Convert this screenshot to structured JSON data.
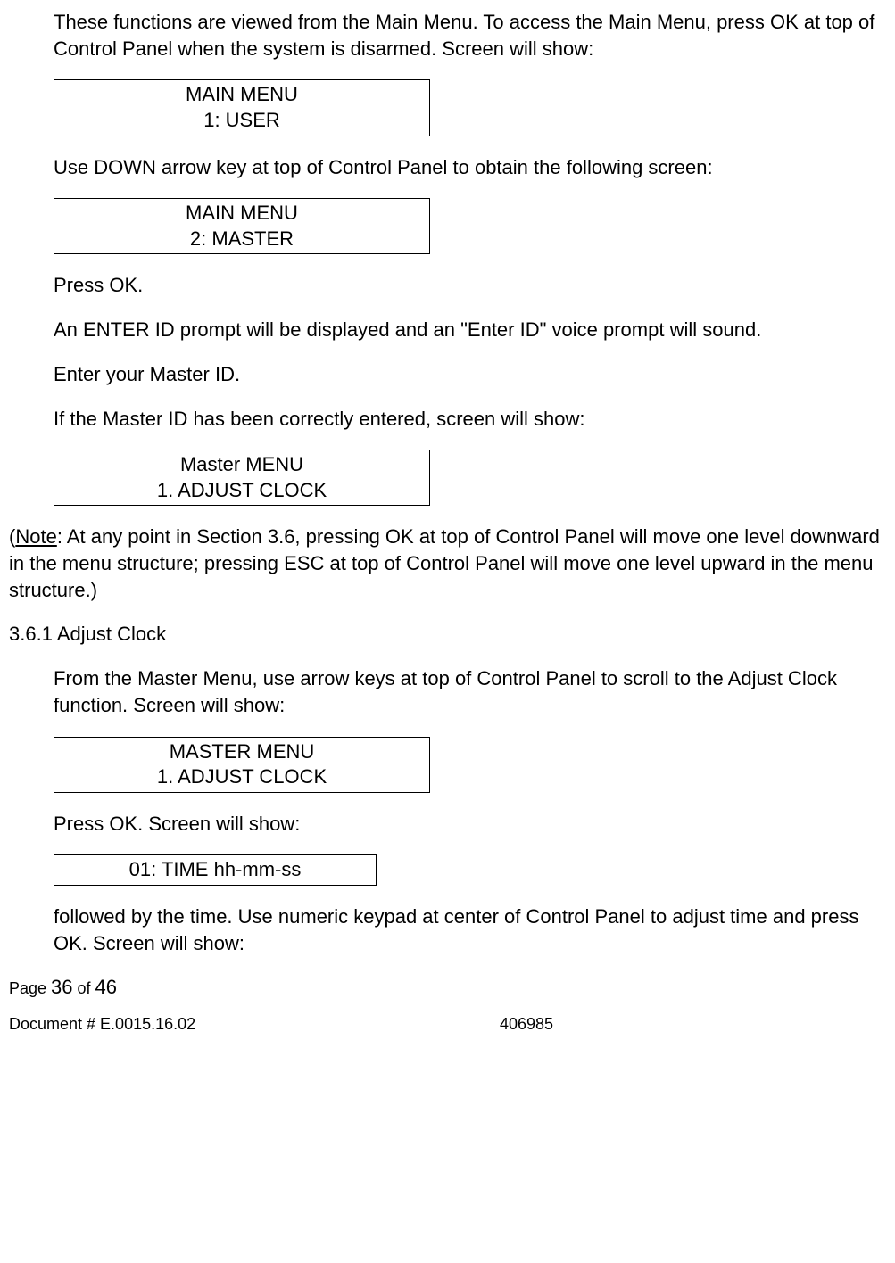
{
  "para1": "These functions are viewed from the Main Menu. To access the Main Menu, press OK at top of Control Panel when the system is disarmed. Screen will show:",
  "screen1": {
    "line1": "MAIN MENU",
    "line2": "1: USER"
  },
  "para2": "Use DOWN arrow key at top of Control Panel to obtain the following screen:",
  "screen2": {
    "line1": "MAIN MENU",
    "line2": "2: MASTER"
  },
  "para3": "Press OK.",
  "para4": "An ENTER ID prompt will be displayed and an \"Enter ID\" voice prompt will sound.",
  "para5": "Enter your Master ID.",
  "para6": "If the Master ID has been correctly entered, screen will show:",
  "screen3": {
    "line1": "Master MENU",
    "line2": "1. ADJUST CLOCK"
  },
  "note_label": "Note",
  "note_rest": ": At any point in Section 3.6, pressing OK at top of Control Panel will move one level downward in the menu structure; pressing ESC at top of Control Panel will move one level upward in the menu structure.)",
  "section_heading": "3.6.1 Adjust Clock",
  "para7": "From the Master Menu, use arrow keys at top of Control Panel to scroll to the Adjust Clock function. Screen will show:",
  "screen4": {
    "line1": "MASTER MENU",
    "line2": "1. ADJUST CLOCK"
  },
  "para8": "Press OK. Screen will show:",
  "screen5": {
    "line1": "01: TIME hh-mm-ss"
  },
  "para9": "followed by the time. Use numeric keypad at center of Control Panel to adjust time and press OK. Screen will show:",
  "footer": {
    "page_label": "Page ",
    "page_current": "36",
    "page_of": "  of   ",
    "page_total": "46",
    "doc_label": "Document # E.0015.16.02",
    "doc_number": "406985"
  }
}
